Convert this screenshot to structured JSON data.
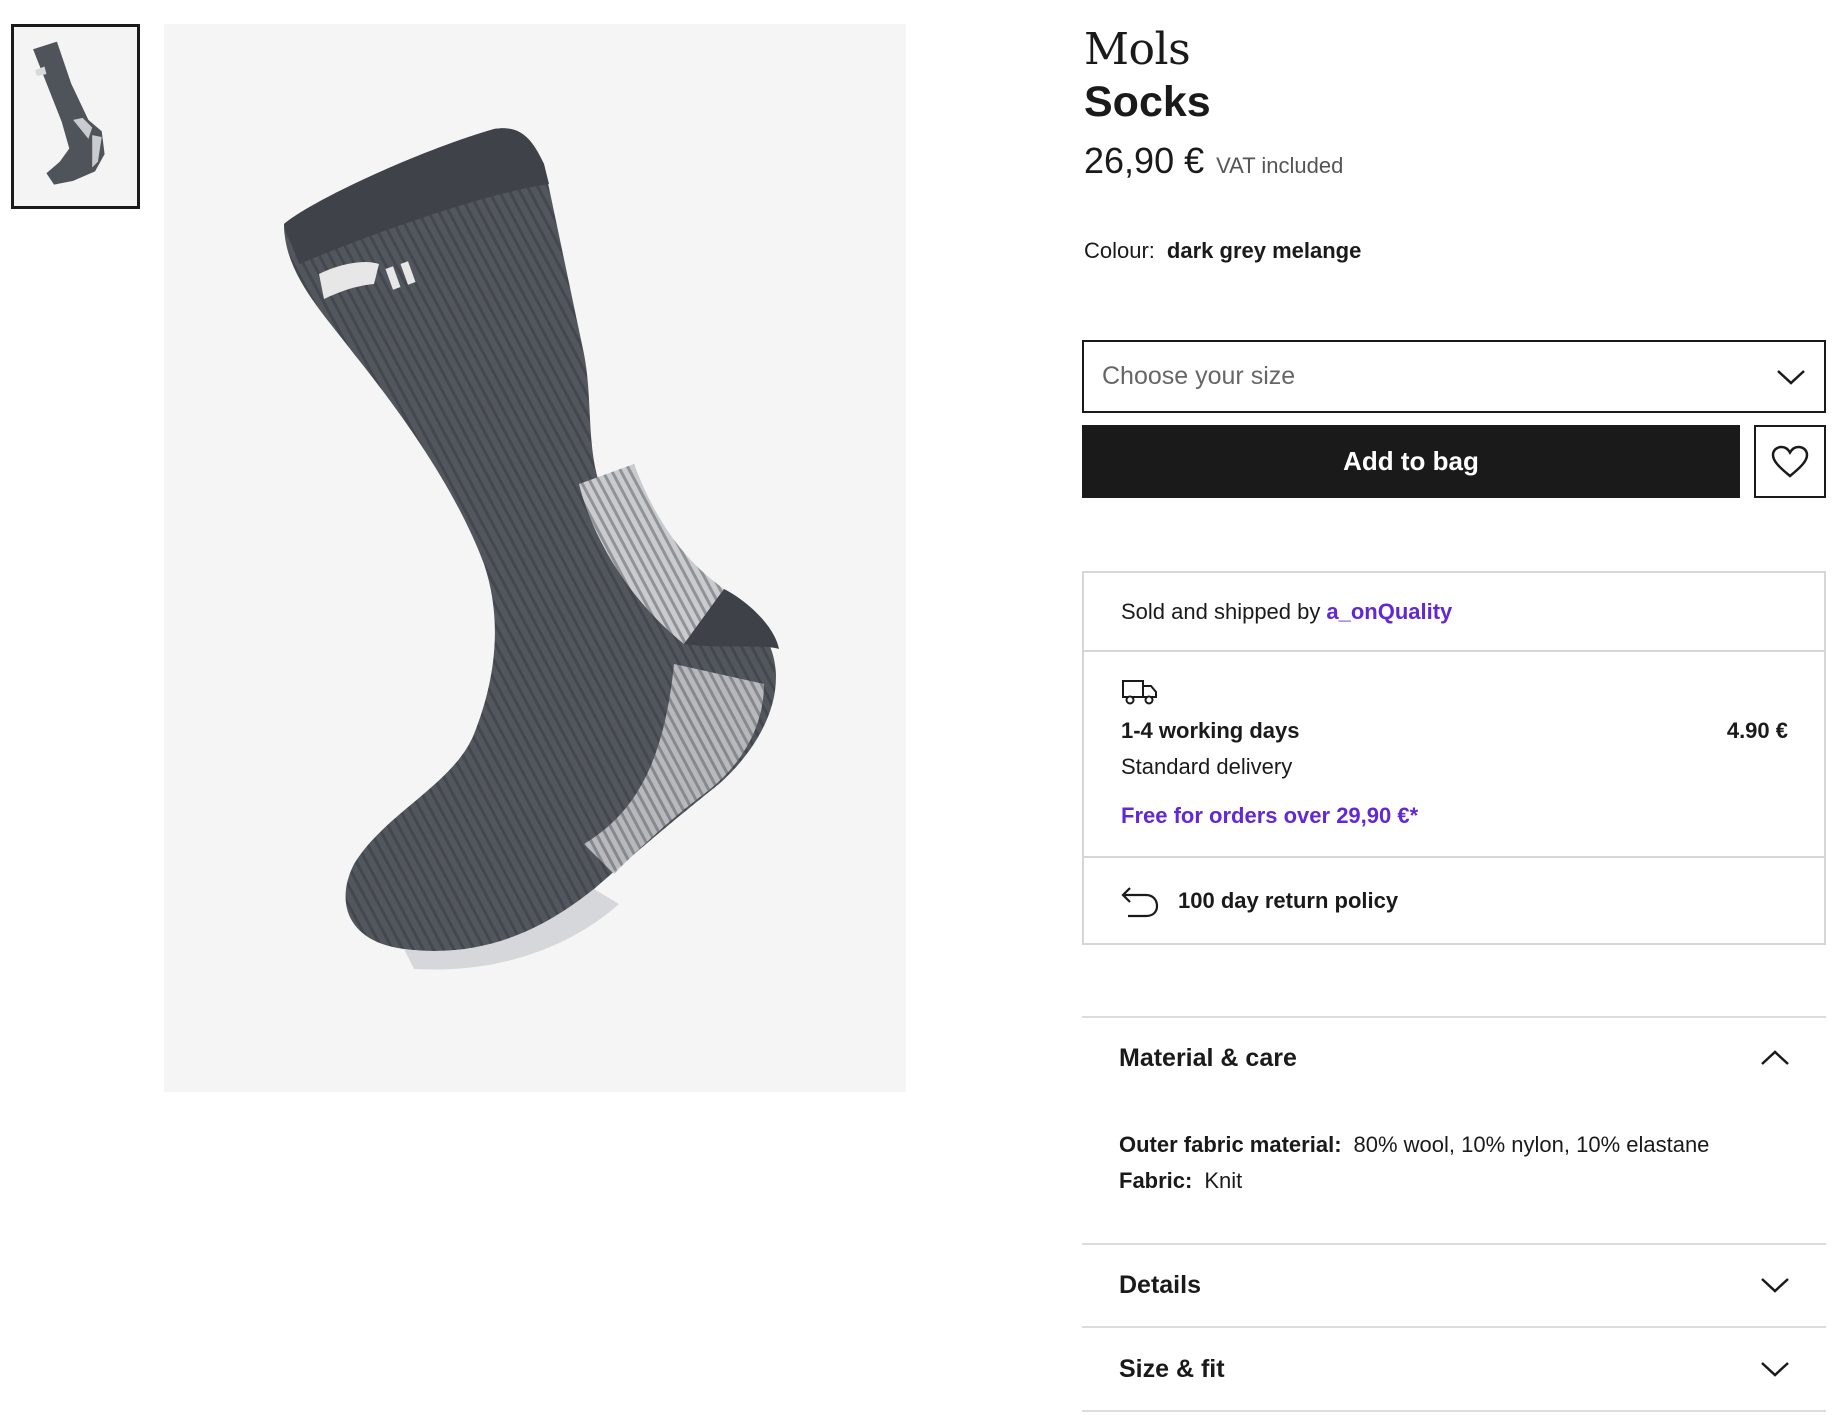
{
  "gallery": {
    "thumbnail_alt": "Socks thumbnail",
    "main_image_alt": "Mols Socks in dark grey melange"
  },
  "product": {
    "brand": "Mols",
    "name": "Socks",
    "price": "26,90 €",
    "vat_note": "VAT included",
    "colour_label": "Colour:",
    "colour_value": "dark grey melange"
  },
  "size_select": {
    "placeholder": "Choose your size"
  },
  "actions": {
    "add_to_bag": "Add to bag"
  },
  "shipping": {
    "sold_by_text": "Sold and shipped by",
    "seller": "a_onQuality",
    "delivery_days": "1-4 working days",
    "delivery_cost": "4.90 €",
    "delivery_method": "Standard delivery",
    "free_shipping": "Free for orders over 29,90 €*",
    "return_policy": "100 day return policy"
  },
  "accordions": {
    "material": {
      "title": "Material & care",
      "rows": [
        {
          "label": "Outer fabric material:",
          "value": "80% wool, 10% nylon, 10% elastane"
        },
        {
          "label": "Fabric:",
          "value": "Knit"
        }
      ]
    },
    "details": {
      "title": "Details"
    },
    "size_fit": {
      "title": "Size & fit"
    }
  },
  "colors": {
    "text": "#1a1a1a",
    "accent_purple": "#6328d4",
    "border": "#d6d6d6",
    "image_bg": "#f5f5f5",
    "sock_dark": "#4f535a",
    "sock_light": "#c9cbce"
  }
}
